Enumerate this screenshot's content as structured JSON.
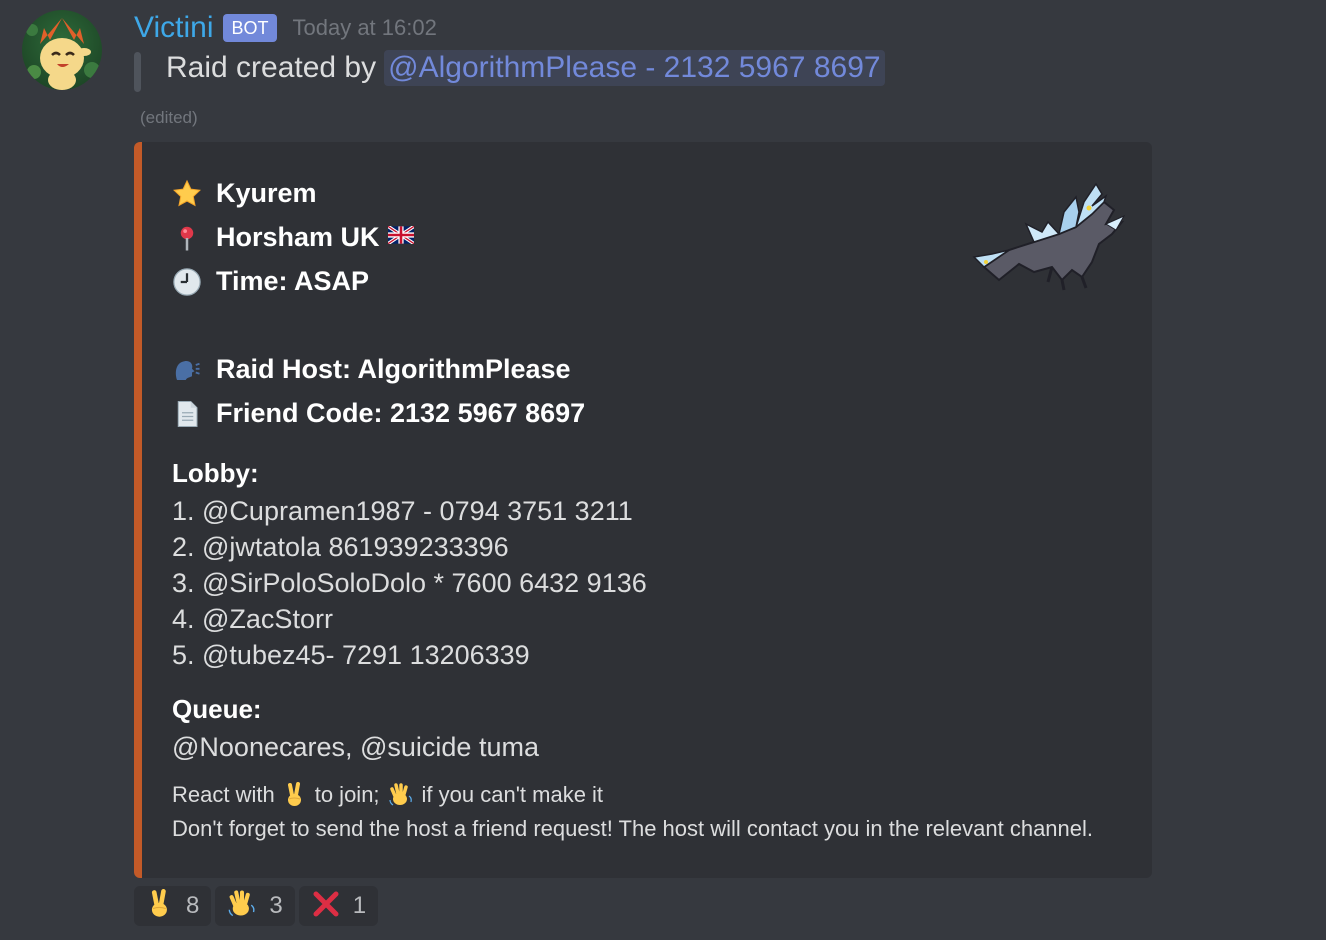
{
  "message": {
    "username": "Victini",
    "bot_tag": "BOT",
    "timestamp": "Today at 16:02",
    "raid_prefix": "Raid created by",
    "mention": "@AlgorithmPlease - 2132 5967 8697",
    "edited": "(edited)"
  },
  "embed": {
    "accent_color": "#c35a28",
    "pokemon": "Kyurem",
    "location": "Horsham UK",
    "time": "Time: ASAP",
    "host": "Raid Host: AlgorithmPlease",
    "friend_code": "Friend Code: 2132 5967 8697",
    "lobby_title": "Lobby:",
    "lobby": [
      "1. @Cupramen1987 - 0794 3751 3211",
      "2. @jwtatola 861939233396",
      "3. @SirPoloSoloDolo * 7600 6432 9136",
      "4. @ZacStorr",
      "5. @tubez45- 7291 13206339"
    ],
    "queue_title": "Queue:",
    "queue": "@Noonecares, @suicide tuma",
    "react_prefix": "React with",
    "react_join": "to join;",
    "react_cant": "if you can't make it",
    "reminder": "Don't forget to send the host a friend request! The host will contact you in the relevant channel."
  },
  "reactions": [
    {
      "icon": "victory-hand-icon",
      "count": "8"
    },
    {
      "icon": "waving-hand-icon",
      "count": "3"
    },
    {
      "icon": "cross-mark-icon",
      "count": "1"
    }
  ],
  "icons": {
    "pokemon": "star-icon",
    "location": "pushpin-icon",
    "time": "clock-icon",
    "host": "speaking-head-icon",
    "friend_code": "page-icon",
    "flag": "uk-flag-icon"
  }
}
